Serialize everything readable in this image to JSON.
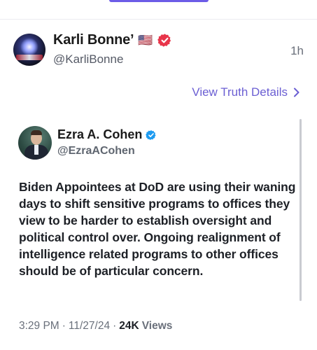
{
  "post": {
    "author": {
      "display_name": "Karli Bonne’",
      "flag_emoji": "🇺🇸",
      "handle": "@KarliBonne",
      "avatar": "profile-avatar-image"
    },
    "relative_time": "1h",
    "view_details_label": "View Truth Details"
  },
  "quoted": {
    "author": {
      "display_name": "Ezra A. Cohen",
      "handle": "@EzraACohen",
      "avatar": "profile-avatar-image"
    },
    "body": "Biden Appointees at DoD are using their waning days to shift sensitive programs to offices they view to be harder to establish oversight and political control over. Ongoing realignment of intelligence related programs to other offices should be of particular concern.",
    "time": "3:29 PM",
    "date": "11/27/24",
    "separator": "·",
    "views_count": "24K",
    "views_label": "Views"
  },
  "icons": {
    "verified_red": "verified-badge-red-icon",
    "verified_blue": "verified-badge-blue-icon",
    "chevron": "chevron-right-icon"
  },
  "colors": {
    "accent_purple": "#6b5fd3",
    "verified_red": "#e8354a",
    "verified_blue": "#1d9bf0",
    "tab_indicator": "#6c5ce7"
  }
}
